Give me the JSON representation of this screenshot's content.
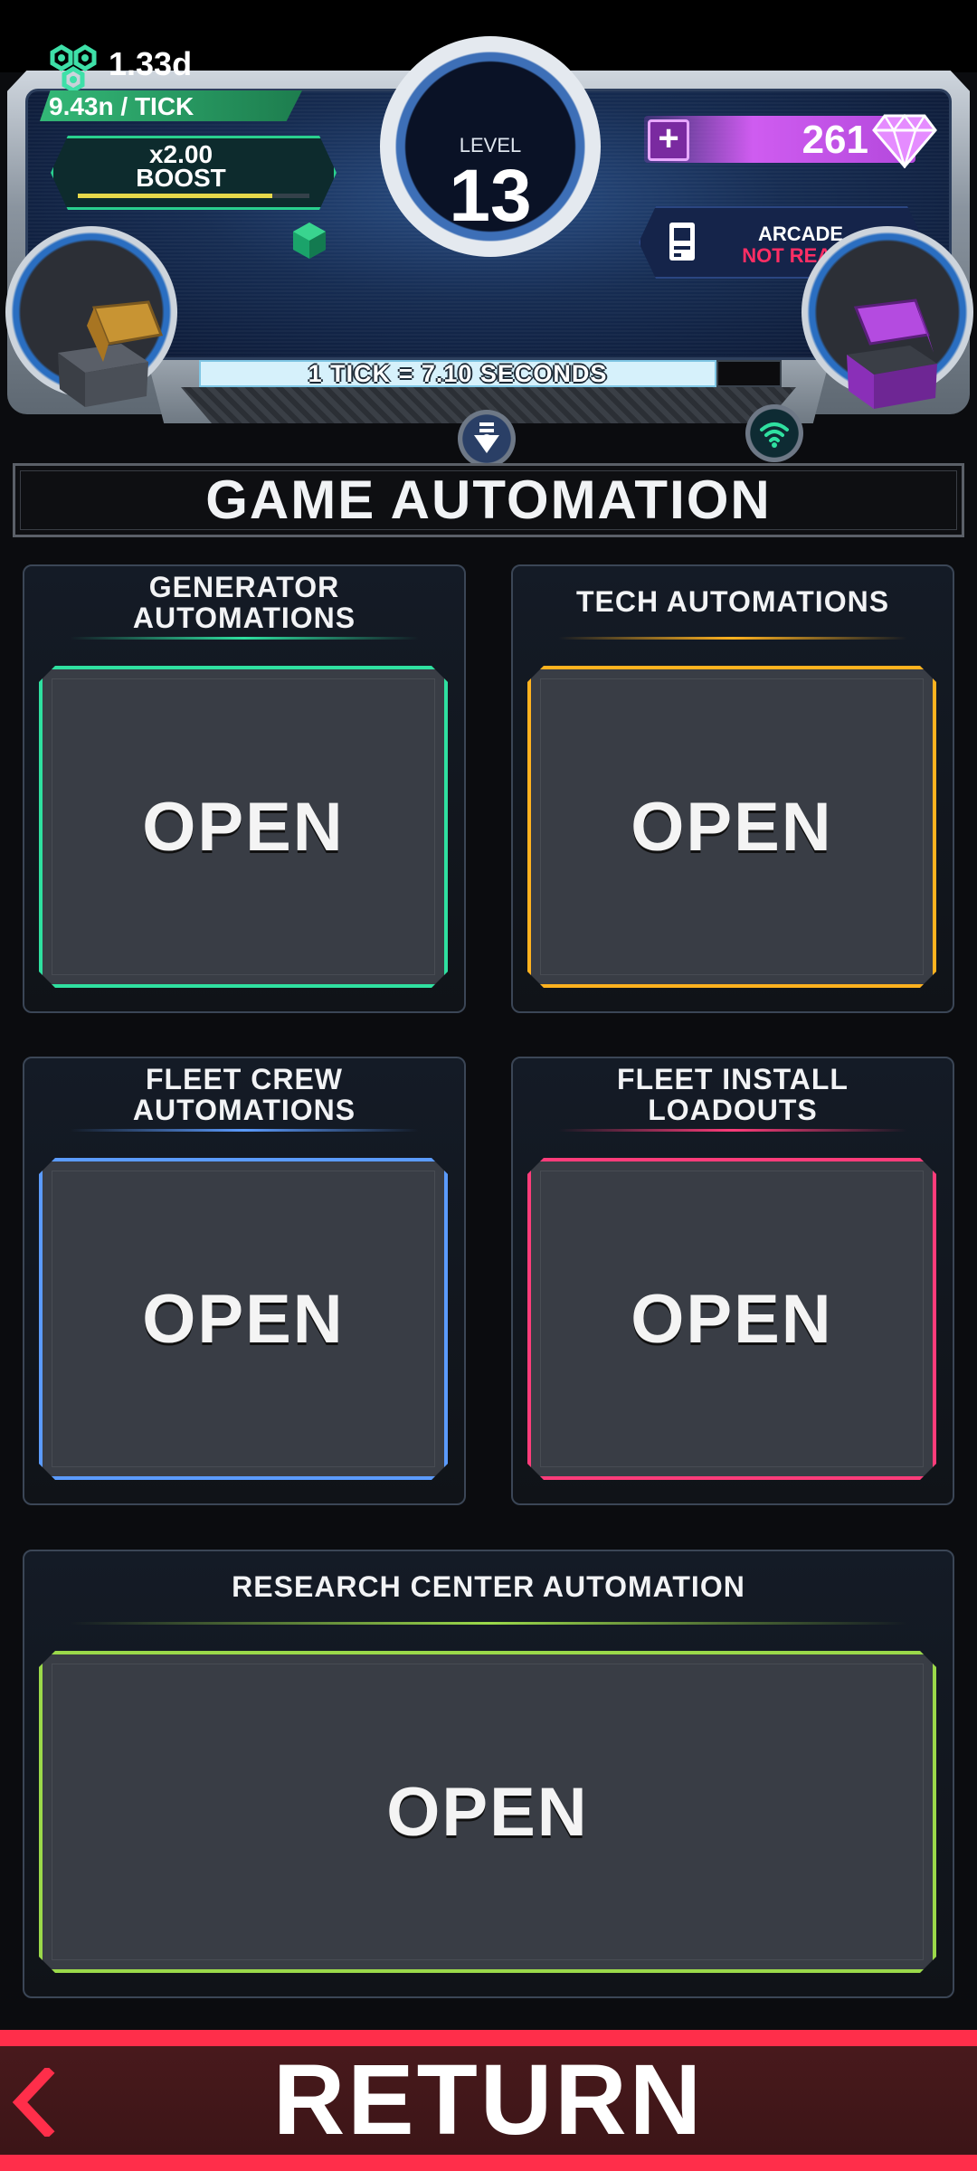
{
  "hud": {
    "currency": "1.33d",
    "tick_rate": "9.43n / TICK",
    "boost_label": "x2.00\nBOOST",
    "boost_progress": 0.84,
    "level_label": "LEVEL",
    "level": "13",
    "gems": "261",
    "gem_plus": "+",
    "arcade_title": "ARCADE",
    "arcade_status": "NOT READY",
    "tick_info": "1 TICK = 7.10 SECONDS"
  },
  "page": {
    "title": "GAME AUTOMATION"
  },
  "cards": [
    {
      "title": "GENERATOR\nAUTOMATIONS",
      "button": "OPEN",
      "accent": "#2fe0a0"
    },
    {
      "title": "TECH AUTOMATIONS",
      "button": "OPEN",
      "accent": "#ffb21f"
    },
    {
      "title": "FLEET CREW\nAUTOMATIONS",
      "button": "OPEN",
      "accent": "#5b9bff"
    },
    {
      "title": "FLEET INSTALL\nLOADOUTS",
      "button": "OPEN",
      "accent": "#ff3c7a"
    },
    {
      "title": "RESEARCH CENTER AUTOMATION",
      "button": "OPEN",
      "accent": "#9bd94a"
    }
  ],
  "footer": {
    "return_label": "RETURN",
    "accent": "#ff2e4a"
  },
  "icons": [
    "molecule-icon",
    "cube-icon",
    "gem-icon",
    "arcade-icon",
    "chest-icon",
    "down-arrow-icon",
    "wifi-icon",
    "chevron-left-icon"
  ]
}
